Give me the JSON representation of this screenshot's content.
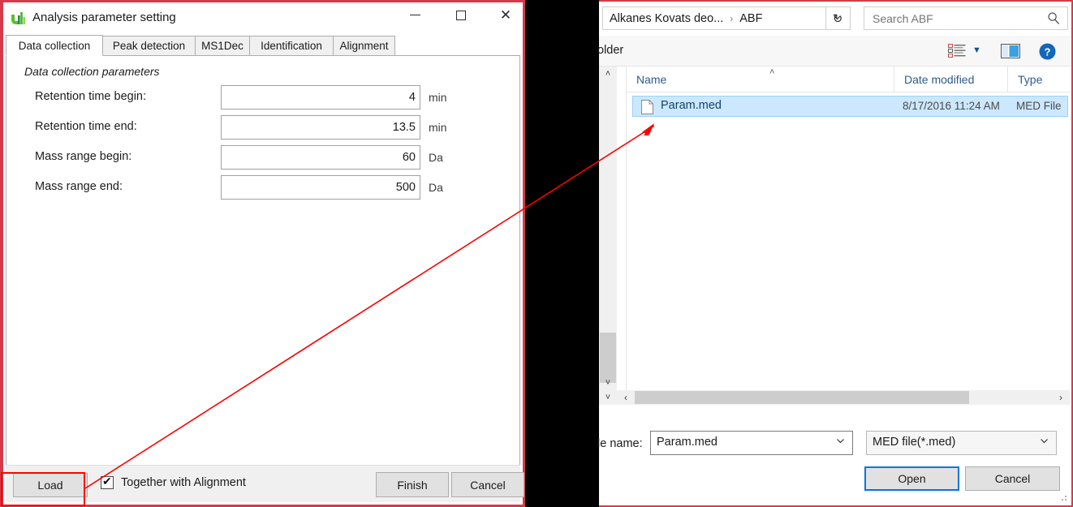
{
  "param_dialog": {
    "title": "Analysis parameter setting",
    "app_icon": "ms-dial-chart-icon",
    "window_buttons": {
      "minimize": "–",
      "maximize": "□",
      "close": "✕"
    },
    "tabs": [
      {
        "label": "Data collection",
        "active": true
      },
      {
        "label": "Peak detection",
        "active": false
      },
      {
        "label": "MS1Dec",
        "active": false
      },
      {
        "label": "Identification",
        "active": false
      },
      {
        "label": "Alignment",
        "active": false
      }
    ],
    "section_title": "Data collection parameters",
    "fields": [
      {
        "label": "Retention time begin:",
        "value": "4",
        "unit": "min"
      },
      {
        "label": "Retention time end:",
        "value": "13.5",
        "unit": "min"
      },
      {
        "label": "Mass range begin:",
        "value": "60",
        "unit": "Da"
      },
      {
        "label": "Mass range end:",
        "value": "500",
        "unit": "Da"
      }
    ],
    "footer": {
      "load_label": "Load",
      "checkbox_label": "Together with Alignment",
      "checkbox_checked": true,
      "finish_label": "Finish",
      "cancel_label": "Cancel"
    }
  },
  "file_dialog": {
    "breadcrumb": {
      "parent": "Alkanes Kovats deo...",
      "separator": "›",
      "current": "ABF",
      "dropdown_icon": "chevron-down-icon",
      "refresh_icon": "↻"
    },
    "search": {
      "placeholder": "Search ABF",
      "value": "",
      "icon": "search-icon"
    },
    "toolbar": {
      "new_folder_label": "older",
      "view_icon": "view-list-icon",
      "view_chevron": "▼",
      "preview_pane_icon": "preview-pane-icon",
      "help_icon": "help-icon"
    },
    "columns": [
      {
        "label": "Name",
        "sorted": true,
        "sort_icon": "˄"
      },
      {
        "label": "Date modified",
        "sorted": false
      },
      {
        "label": "Type",
        "sorted": false
      }
    ],
    "files": [
      {
        "icon": "document-file-icon",
        "name": "Param.med",
        "date_modified": "8/17/2016 11:24 AM",
        "type": "MED File",
        "selected": true
      }
    ],
    "scrollbars": {
      "vertical_up": "˄",
      "vertical_down": "˅",
      "horizontal_left": "‹",
      "horizontal_right": "›"
    },
    "bottom": {
      "file_name_label": "le name:",
      "file_name_value": "Param.med",
      "file_name_chevron": "chevron-down-icon",
      "filter_value": "MED file(*.med)",
      "filter_chevron": "chevron-down-icon",
      "open_label": "Open",
      "cancel_label": "Cancel"
    }
  },
  "annotation": {
    "highlight_target": "Load",
    "arrow_color": "#ff0000",
    "highlight_color": "#ff0000"
  }
}
